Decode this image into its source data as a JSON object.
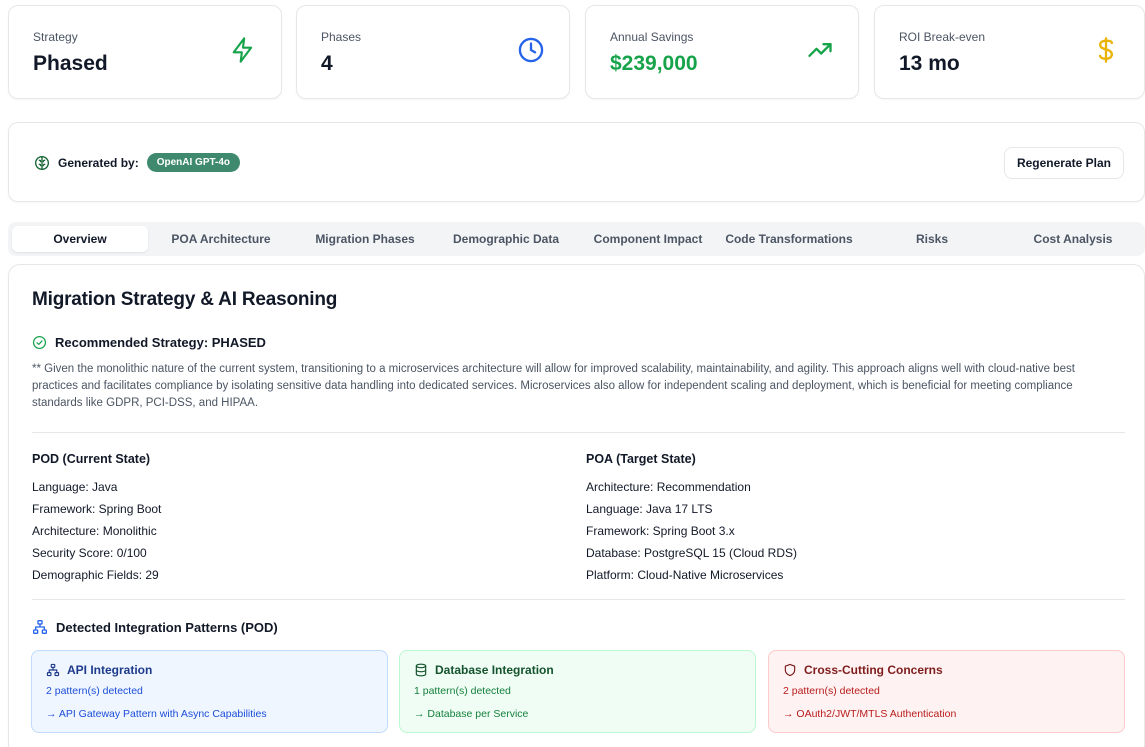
{
  "metrics": [
    {
      "label": "Strategy",
      "value": "Phased",
      "icon": "zap-icon",
      "color": "#16a34a"
    },
    {
      "label": "Phases",
      "value": "4",
      "icon": "clock-icon",
      "color": "#2563eb"
    },
    {
      "label": "Annual Savings",
      "value": "$239,000",
      "icon": "trending-up-icon",
      "color": "#16a34a"
    },
    {
      "label": "ROI Break-even",
      "value": "13 mo",
      "icon": "dollar-icon",
      "color": "#eab308"
    }
  ],
  "generator": {
    "label": "Generated by:",
    "model": "OpenAI GPT-4o",
    "regenerate_label": "Regenerate Plan",
    "icon": "brain-icon"
  },
  "tabs": [
    {
      "label": "Overview",
      "active": true
    },
    {
      "label": "POA Architecture"
    },
    {
      "label": "Migration Phases"
    },
    {
      "label": "Demographic Data"
    },
    {
      "label": "Component Impact"
    },
    {
      "label": "Code Transformations"
    },
    {
      "label": "Risks"
    },
    {
      "label": "Cost Analysis"
    }
  ],
  "overview": {
    "title": "Migration Strategy & AI Reasoning",
    "recommended": "Recommended Strategy: PHASED",
    "reasoning": "** Given the monolithic nature of the current system, transitioning to a microservices architecture will allow for improved scalability, maintainability, and agility. This approach aligns well with cloud-native best practices and facilitates compliance by isolating sensitive data handling into dedicated services. Microservices also allow for independent scaling and deployment, which is beneficial for meeting compliance standards like GDPR, PCI-DSS, and HIPAA.",
    "pod": {
      "title": "POD (Current State)",
      "lines": [
        "Language: Java",
        "Framework: Spring Boot",
        "Architecture: Monolithic",
        "Security Score: 0/100",
        "Demographic Fields: 29"
      ]
    },
    "poa": {
      "title": "POA (Target State)",
      "lines": [
        "Architecture: Recommendation",
        "Language: Java 17 LTS",
        "Framework: Spring Boot 3.x",
        "Database: PostgreSQL 15 (Cloud RDS)",
        "Platform: Cloud-Native Microservices"
      ]
    },
    "integration_title": "Detected Integration Patterns (POD)",
    "patterns": [
      {
        "title": "API Integration",
        "count": "2 pattern(s) detected",
        "target": "→ API Gateway Pattern with Async Capabilities",
        "icon": "network-icon"
      },
      {
        "title": "Database Integration",
        "count": "1 pattern(s) detected",
        "target": "→ Database per Service",
        "icon": "database-icon"
      },
      {
        "title": "Cross-Cutting Concerns",
        "count": "2 pattern(s) detected",
        "target": "→ OAuth2/JWT/MTLS Authentication",
        "icon": "shield-icon"
      }
    ]
  }
}
